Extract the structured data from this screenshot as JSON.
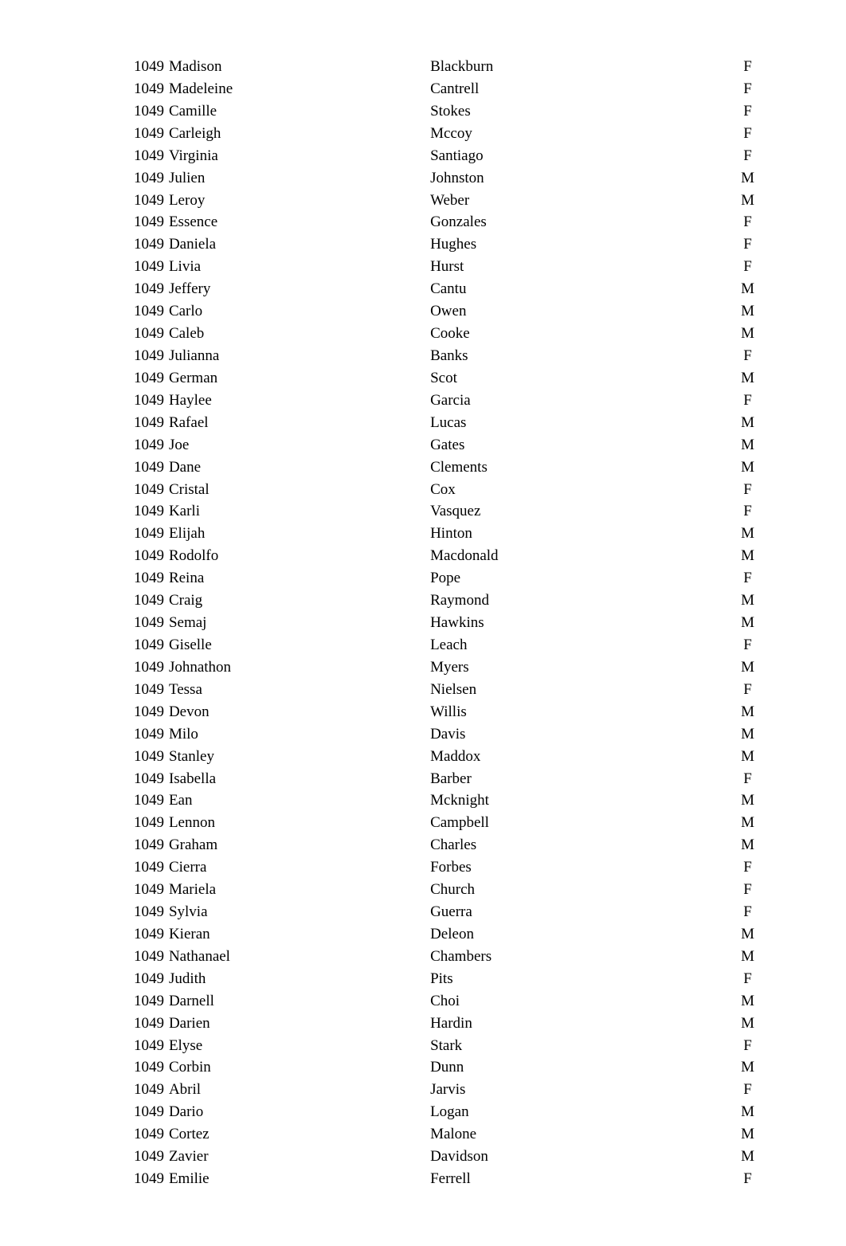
{
  "rows": [
    {
      "id": "1049",
      "first": "Madison",
      "last": "Blackburn",
      "gender": "F"
    },
    {
      "id": "1049",
      "first": "Madeleine",
      "last": "Cantrell",
      "gender": "F"
    },
    {
      "id": "1049",
      "first": "Camille",
      "last": "Stokes",
      "gender": "F"
    },
    {
      "id": "1049",
      "first": "Carleigh",
      "last": "Mccoy",
      "gender": "F"
    },
    {
      "id": "1049",
      "first": "Virginia",
      "last": "Santiago",
      "gender": "F"
    },
    {
      "id": "1049",
      "first": "Julien",
      "last": "Johnston",
      "gender": "M"
    },
    {
      "id": "1049",
      "first": "Leroy",
      "last": "Weber",
      "gender": "M"
    },
    {
      "id": "1049",
      "first": "Essence",
      "last": "Gonzales",
      "gender": "F"
    },
    {
      "id": "1049",
      "first": "Daniela",
      "last": "Hughes",
      "gender": "F"
    },
    {
      "id": "1049",
      "first": "Livia",
      "last": "Hurst",
      "gender": "F"
    },
    {
      "id": "1049",
      "first": "Jeffery",
      "last": "Cantu",
      "gender": "M"
    },
    {
      "id": "1049",
      "first": "Carlo",
      "last": "Owen",
      "gender": "M"
    },
    {
      "id": "1049",
      "first": "Caleb",
      "last": "Cooke",
      "gender": "M"
    },
    {
      "id": "1049",
      "first": "Julianna",
      "last": "Banks",
      "gender": "F"
    },
    {
      "id": "1049",
      "first": "German",
      "last": "Scot",
      "gender": "M"
    },
    {
      "id": "1049",
      "first": "Haylee",
      "last": "Garcia",
      "gender": "F"
    },
    {
      "id": "1049",
      "first": "Rafael",
      "last": "Lucas",
      "gender": "M"
    },
    {
      "id": "1049",
      "first": "Joe",
      "last": "Gates",
      "gender": "M"
    },
    {
      "id": "1049",
      "first": "Dane",
      "last": "Clements",
      "gender": "M"
    },
    {
      "id": "1049",
      "first": "Cristal",
      "last": "Cox",
      "gender": "F"
    },
    {
      "id": "1049",
      "first": "Karli",
      "last": "Vasquez",
      "gender": "F"
    },
    {
      "id": "1049",
      "first": "Elijah",
      "last": "Hinton",
      "gender": "M"
    },
    {
      "id": "1049",
      "first": "Rodolfo",
      "last": "Macdonald",
      "gender": "M"
    },
    {
      "id": "1049",
      "first": "Reina",
      "last": "Pope",
      "gender": "F"
    },
    {
      "id": "1049",
      "first": "Craig",
      "last": "Raymond",
      "gender": "M"
    },
    {
      "id": "1049",
      "first": "Semaj",
      "last": "Hawkins",
      "gender": "M"
    },
    {
      "id": "1049",
      "first": "Giselle",
      "last": "Leach",
      "gender": "F"
    },
    {
      "id": "1049",
      "first": "Johnathon",
      "last": "Myers",
      "gender": "M"
    },
    {
      "id": "1049",
      "first": "Tessa",
      "last": "Nielsen",
      "gender": "F"
    },
    {
      "id": "1049",
      "first": "Devon",
      "last": "Willis",
      "gender": "M"
    },
    {
      "id": "1049",
      "first": "Milo",
      "last": "Davis",
      "gender": "M"
    },
    {
      "id": "1049",
      "first": "Stanley",
      "last": "Maddox",
      "gender": "M"
    },
    {
      "id": "1049",
      "first": "Isabella",
      "last": "Barber",
      "gender": "F"
    },
    {
      "id": "1049",
      "first": "Ean",
      "last": "Mcknight",
      "gender": "M"
    },
    {
      "id": "1049",
      "first": "Lennon",
      "last": "Campbell",
      "gender": "M"
    },
    {
      "id": "1049",
      "first": "Graham",
      "last": "Charles",
      "gender": "M"
    },
    {
      "id": "1049",
      "first": "Cierra",
      "last": "Forbes",
      "gender": "F"
    },
    {
      "id": "1049",
      "first": "Mariela",
      "last": "Church",
      "gender": "F"
    },
    {
      "id": "1049",
      "first": "Sylvia",
      "last": "Guerra",
      "gender": "F"
    },
    {
      "id": "1049",
      "first": "Kieran",
      "last": "Deleon",
      "gender": "M"
    },
    {
      "id": "1049",
      "first": "Nathanael",
      "last": "Chambers",
      "gender": "M"
    },
    {
      "id": "1049",
      "first": "Judith",
      "last": "Pits",
      "gender": "F"
    },
    {
      "id": "1049",
      "first": "Darnell",
      "last": "Choi",
      "gender": "M"
    },
    {
      "id": "1049",
      "first": "Darien",
      "last": "Hardin",
      "gender": "M"
    },
    {
      "id": "1049",
      "first": "Elyse",
      "last": "Stark",
      "gender": "F"
    },
    {
      "id": "1049",
      "first": "Corbin",
      "last": "Dunn",
      "gender": "M"
    },
    {
      "id": "1049",
      "first": "Abril",
      "last": "Jarvis",
      "gender": "F"
    },
    {
      "id": "1049",
      "first": "Dario",
      "last": "Logan",
      "gender": "M"
    },
    {
      "id": "1049",
      "first": "Cortez",
      "last": "Malone",
      "gender": "M"
    },
    {
      "id": "1049",
      "first": "Zavier",
      "last": "Davidson",
      "gender": "M"
    },
    {
      "id": "1049",
      "first": "Emilie",
      "last": "Ferrell",
      "gender": "F"
    }
  ]
}
